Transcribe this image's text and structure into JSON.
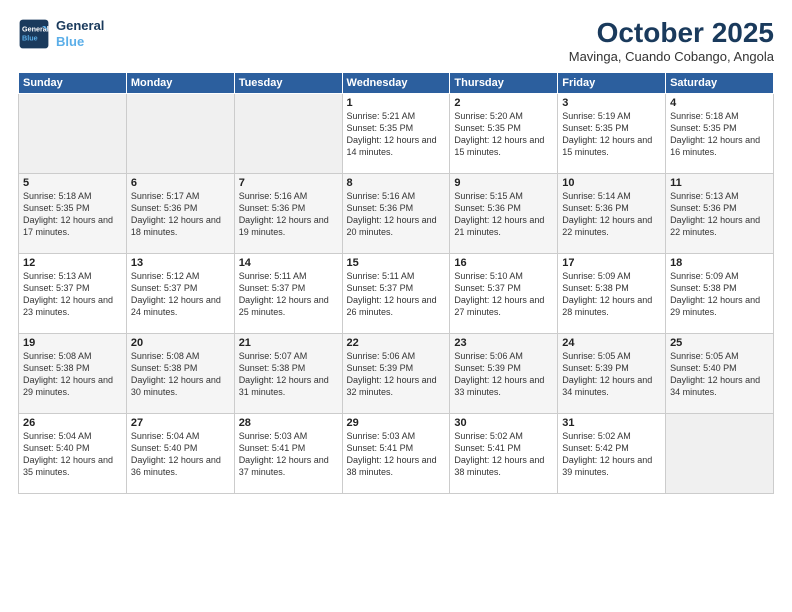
{
  "header": {
    "logo_line1": "General",
    "logo_line2": "Blue",
    "month_title": "October 2025",
    "subtitle": "Mavinga, Cuando Cobango, Angola"
  },
  "weekdays": [
    "Sunday",
    "Monday",
    "Tuesday",
    "Wednesday",
    "Thursday",
    "Friday",
    "Saturday"
  ],
  "weeks": [
    [
      {
        "day": "",
        "empty": true
      },
      {
        "day": "",
        "empty": true
      },
      {
        "day": "",
        "empty": true
      },
      {
        "day": "1",
        "sunrise": "5:21 AM",
        "sunset": "5:35 PM",
        "daylight": "12 hours and 14 minutes."
      },
      {
        "day": "2",
        "sunrise": "5:20 AM",
        "sunset": "5:35 PM",
        "daylight": "12 hours and 15 minutes."
      },
      {
        "day": "3",
        "sunrise": "5:19 AM",
        "sunset": "5:35 PM",
        "daylight": "12 hours and 15 minutes."
      },
      {
        "day": "4",
        "sunrise": "5:18 AM",
        "sunset": "5:35 PM",
        "daylight": "12 hours and 16 minutes."
      }
    ],
    [
      {
        "day": "5",
        "sunrise": "5:18 AM",
        "sunset": "5:35 PM",
        "daylight": "12 hours and 17 minutes."
      },
      {
        "day": "6",
        "sunrise": "5:17 AM",
        "sunset": "5:36 PM",
        "daylight": "12 hours and 18 minutes."
      },
      {
        "day": "7",
        "sunrise": "5:16 AM",
        "sunset": "5:36 PM",
        "daylight": "12 hours and 19 minutes."
      },
      {
        "day": "8",
        "sunrise": "5:16 AM",
        "sunset": "5:36 PM",
        "daylight": "12 hours and 20 minutes."
      },
      {
        "day": "9",
        "sunrise": "5:15 AM",
        "sunset": "5:36 PM",
        "daylight": "12 hours and 21 minutes."
      },
      {
        "day": "10",
        "sunrise": "5:14 AM",
        "sunset": "5:36 PM",
        "daylight": "12 hours and 22 minutes."
      },
      {
        "day": "11",
        "sunrise": "5:13 AM",
        "sunset": "5:36 PM",
        "daylight": "12 hours and 22 minutes."
      }
    ],
    [
      {
        "day": "12",
        "sunrise": "5:13 AM",
        "sunset": "5:37 PM",
        "daylight": "12 hours and 23 minutes."
      },
      {
        "day": "13",
        "sunrise": "5:12 AM",
        "sunset": "5:37 PM",
        "daylight": "12 hours and 24 minutes."
      },
      {
        "day": "14",
        "sunrise": "5:11 AM",
        "sunset": "5:37 PM",
        "daylight": "12 hours and 25 minutes."
      },
      {
        "day": "15",
        "sunrise": "5:11 AM",
        "sunset": "5:37 PM",
        "daylight": "12 hours and 26 minutes."
      },
      {
        "day": "16",
        "sunrise": "5:10 AM",
        "sunset": "5:37 PM",
        "daylight": "12 hours and 27 minutes."
      },
      {
        "day": "17",
        "sunrise": "5:09 AM",
        "sunset": "5:38 PM",
        "daylight": "12 hours and 28 minutes."
      },
      {
        "day": "18",
        "sunrise": "5:09 AM",
        "sunset": "5:38 PM",
        "daylight": "12 hours and 29 minutes."
      }
    ],
    [
      {
        "day": "19",
        "sunrise": "5:08 AM",
        "sunset": "5:38 PM",
        "daylight": "12 hours and 29 minutes."
      },
      {
        "day": "20",
        "sunrise": "5:08 AM",
        "sunset": "5:38 PM",
        "daylight": "12 hours and 30 minutes."
      },
      {
        "day": "21",
        "sunrise": "5:07 AM",
        "sunset": "5:38 PM",
        "daylight": "12 hours and 31 minutes."
      },
      {
        "day": "22",
        "sunrise": "5:06 AM",
        "sunset": "5:39 PM",
        "daylight": "12 hours and 32 minutes."
      },
      {
        "day": "23",
        "sunrise": "5:06 AM",
        "sunset": "5:39 PM",
        "daylight": "12 hours and 33 minutes."
      },
      {
        "day": "24",
        "sunrise": "5:05 AM",
        "sunset": "5:39 PM",
        "daylight": "12 hours and 34 minutes."
      },
      {
        "day": "25",
        "sunrise": "5:05 AM",
        "sunset": "5:40 PM",
        "daylight": "12 hours and 34 minutes."
      }
    ],
    [
      {
        "day": "26",
        "sunrise": "5:04 AM",
        "sunset": "5:40 PM",
        "daylight": "12 hours and 35 minutes."
      },
      {
        "day": "27",
        "sunrise": "5:04 AM",
        "sunset": "5:40 PM",
        "daylight": "12 hours and 36 minutes."
      },
      {
        "day": "28",
        "sunrise": "5:03 AM",
        "sunset": "5:41 PM",
        "daylight": "12 hours and 37 minutes."
      },
      {
        "day": "29",
        "sunrise": "5:03 AM",
        "sunset": "5:41 PM",
        "daylight": "12 hours and 38 minutes."
      },
      {
        "day": "30",
        "sunrise": "5:02 AM",
        "sunset": "5:41 PM",
        "daylight": "12 hours and 38 minutes."
      },
      {
        "day": "31",
        "sunrise": "5:02 AM",
        "sunset": "5:42 PM",
        "daylight": "12 hours and 39 minutes."
      },
      {
        "day": "",
        "empty": true
      }
    ]
  ]
}
